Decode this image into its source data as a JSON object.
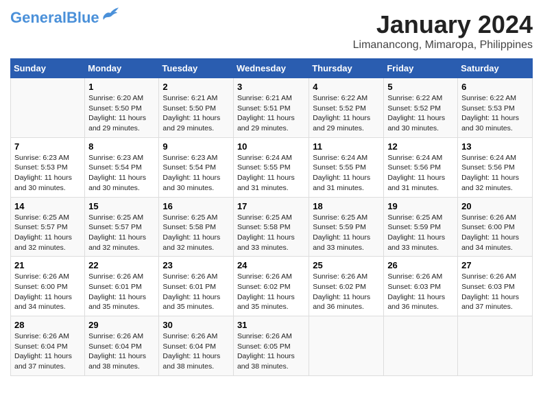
{
  "header": {
    "logo_general": "General",
    "logo_blue": "Blue",
    "title": "January 2024",
    "subtitle": "Limanancong, Mimaropa, Philippines"
  },
  "days_of_week": [
    "Sunday",
    "Monday",
    "Tuesday",
    "Wednesday",
    "Thursday",
    "Friday",
    "Saturday"
  ],
  "weeks": [
    [
      {
        "day": "",
        "info": ""
      },
      {
        "day": "1",
        "info": "Sunrise: 6:20 AM\nSunset: 5:50 PM\nDaylight: 11 hours\nand 29 minutes."
      },
      {
        "day": "2",
        "info": "Sunrise: 6:21 AM\nSunset: 5:50 PM\nDaylight: 11 hours\nand 29 minutes."
      },
      {
        "day": "3",
        "info": "Sunrise: 6:21 AM\nSunset: 5:51 PM\nDaylight: 11 hours\nand 29 minutes."
      },
      {
        "day": "4",
        "info": "Sunrise: 6:22 AM\nSunset: 5:52 PM\nDaylight: 11 hours\nand 29 minutes."
      },
      {
        "day": "5",
        "info": "Sunrise: 6:22 AM\nSunset: 5:52 PM\nDaylight: 11 hours\nand 30 minutes."
      },
      {
        "day": "6",
        "info": "Sunrise: 6:22 AM\nSunset: 5:53 PM\nDaylight: 11 hours\nand 30 minutes."
      }
    ],
    [
      {
        "day": "7",
        "info": "Sunrise: 6:23 AM\nSunset: 5:53 PM\nDaylight: 11 hours\nand 30 minutes."
      },
      {
        "day": "8",
        "info": "Sunrise: 6:23 AM\nSunset: 5:54 PM\nDaylight: 11 hours\nand 30 minutes."
      },
      {
        "day": "9",
        "info": "Sunrise: 6:23 AM\nSunset: 5:54 PM\nDaylight: 11 hours\nand 30 minutes."
      },
      {
        "day": "10",
        "info": "Sunrise: 6:24 AM\nSunset: 5:55 PM\nDaylight: 11 hours\nand 31 minutes."
      },
      {
        "day": "11",
        "info": "Sunrise: 6:24 AM\nSunset: 5:55 PM\nDaylight: 11 hours\nand 31 minutes."
      },
      {
        "day": "12",
        "info": "Sunrise: 6:24 AM\nSunset: 5:56 PM\nDaylight: 11 hours\nand 31 minutes."
      },
      {
        "day": "13",
        "info": "Sunrise: 6:24 AM\nSunset: 5:56 PM\nDaylight: 11 hours\nand 32 minutes."
      }
    ],
    [
      {
        "day": "14",
        "info": "Sunrise: 6:25 AM\nSunset: 5:57 PM\nDaylight: 11 hours\nand 32 minutes."
      },
      {
        "day": "15",
        "info": "Sunrise: 6:25 AM\nSunset: 5:57 PM\nDaylight: 11 hours\nand 32 minutes."
      },
      {
        "day": "16",
        "info": "Sunrise: 6:25 AM\nSunset: 5:58 PM\nDaylight: 11 hours\nand 32 minutes."
      },
      {
        "day": "17",
        "info": "Sunrise: 6:25 AM\nSunset: 5:58 PM\nDaylight: 11 hours\nand 33 minutes."
      },
      {
        "day": "18",
        "info": "Sunrise: 6:25 AM\nSunset: 5:59 PM\nDaylight: 11 hours\nand 33 minutes."
      },
      {
        "day": "19",
        "info": "Sunrise: 6:25 AM\nSunset: 5:59 PM\nDaylight: 11 hours\nand 33 minutes."
      },
      {
        "day": "20",
        "info": "Sunrise: 6:26 AM\nSunset: 6:00 PM\nDaylight: 11 hours\nand 34 minutes."
      }
    ],
    [
      {
        "day": "21",
        "info": "Sunrise: 6:26 AM\nSunset: 6:00 PM\nDaylight: 11 hours\nand 34 minutes."
      },
      {
        "day": "22",
        "info": "Sunrise: 6:26 AM\nSunset: 6:01 PM\nDaylight: 11 hours\nand 35 minutes."
      },
      {
        "day": "23",
        "info": "Sunrise: 6:26 AM\nSunset: 6:01 PM\nDaylight: 11 hours\nand 35 minutes."
      },
      {
        "day": "24",
        "info": "Sunrise: 6:26 AM\nSunset: 6:02 PM\nDaylight: 11 hours\nand 35 minutes."
      },
      {
        "day": "25",
        "info": "Sunrise: 6:26 AM\nSunset: 6:02 PM\nDaylight: 11 hours\nand 36 minutes."
      },
      {
        "day": "26",
        "info": "Sunrise: 6:26 AM\nSunset: 6:03 PM\nDaylight: 11 hours\nand 36 minutes."
      },
      {
        "day": "27",
        "info": "Sunrise: 6:26 AM\nSunset: 6:03 PM\nDaylight: 11 hours\nand 37 minutes."
      }
    ],
    [
      {
        "day": "28",
        "info": "Sunrise: 6:26 AM\nSunset: 6:04 PM\nDaylight: 11 hours\nand 37 minutes."
      },
      {
        "day": "29",
        "info": "Sunrise: 6:26 AM\nSunset: 6:04 PM\nDaylight: 11 hours\nand 38 minutes."
      },
      {
        "day": "30",
        "info": "Sunrise: 6:26 AM\nSunset: 6:04 PM\nDaylight: 11 hours\nand 38 minutes."
      },
      {
        "day": "31",
        "info": "Sunrise: 6:26 AM\nSunset: 6:05 PM\nDaylight: 11 hours\nand 38 minutes."
      },
      {
        "day": "",
        "info": ""
      },
      {
        "day": "",
        "info": ""
      },
      {
        "day": "",
        "info": ""
      }
    ]
  ]
}
